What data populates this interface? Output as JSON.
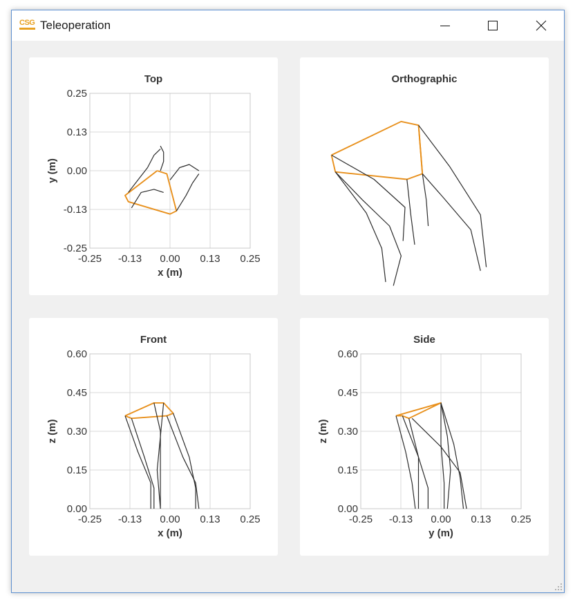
{
  "window": {
    "title": "Teleoperation",
    "logo_text": "CSG",
    "accent": "#e8a020"
  },
  "icons": {
    "minimize": "minimize-icon",
    "maximize": "maximize-icon",
    "close": "close-icon",
    "resize": "resize-grip-icon"
  },
  "colors": {
    "frame": "#e8901c",
    "legs": "#2b2b2b",
    "grid": "#d9d9d9",
    "axis": "#c8c8c8",
    "text": "#333333"
  },
  "chart_data": [
    {
      "type": "line",
      "title": "Top",
      "xlabel": "x (m)",
      "ylabel": "y (m)",
      "xlim": [
        -0.25,
        0.25
      ],
      "ylim": [
        -0.25,
        0.25
      ],
      "xticks": [
        "-0.25",
        "-0.13",
        "0.00",
        "0.13",
        "0.25"
      ],
      "yticks": [
        "-0.25",
        "-0.13",
        "0.00",
        "0.13",
        "0.25"
      ],
      "grid": true,
      "series": [
        {
          "role": "frame",
          "points": [
            [
              -0.04,
              0.0
            ],
            [
              -0.14,
              -0.08
            ],
            [
              -0.13,
              -0.1
            ],
            [
              0.0,
              -0.14
            ],
            [
              0.02,
              -0.13
            ],
            [
              -0.01,
              -0.01
            ],
            [
              -0.04,
              0.0
            ]
          ]
        },
        {
          "role": "leg",
          "points": [
            [
              -0.13,
              -0.07
            ],
            [
              -0.1,
              -0.03
            ],
            [
              -0.07,
              0.01
            ],
            [
              -0.05,
              0.05
            ],
            [
              -0.03,
              0.07
            ]
          ]
        },
        {
          "role": "leg",
          "points": [
            [
              -0.03,
              0.08
            ],
            [
              -0.02,
              0.06
            ],
            [
              -0.02,
              0.03
            ],
            [
              -0.03,
              0.0
            ]
          ]
        },
        {
          "role": "leg",
          "points": [
            [
              0.0,
              -0.03
            ],
            [
              0.03,
              0.01
            ],
            [
              0.06,
              0.02
            ],
            [
              0.09,
              0.0
            ]
          ]
        },
        {
          "role": "leg",
          "points": [
            [
              0.02,
              -0.13
            ],
            [
              0.05,
              -0.08
            ],
            [
              0.07,
              -0.04
            ],
            [
              0.09,
              -0.01
            ]
          ]
        },
        {
          "role": "leg",
          "points": [
            [
              -0.12,
              -0.12
            ],
            [
              -0.09,
              -0.07
            ],
            [
              -0.05,
              -0.06
            ],
            [
              -0.02,
              -0.07
            ]
          ]
        }
      ]
    },
    {
      "type": "line",
      "title": "Orthographic",
      "series": [
        {
          "role": "frame",
          "points": [
            [
              0.02,
              0.32
            ],
            [
              0.38,
              0.14
            ],
            [
              0.47,
              0.16
            ],
            [
              0.49,
              0.42
            ],
            [
              0.41,
              0.45
            ],
            [
              0.04,
              0.41
            ],
            [
              0.02,
              0.32
            ]
          ]
        },
        {
          "role": "frame",
          "points": [
            [
              0.47,
              0.16
            ],
            [
              0.49,
              0.42
            ]
          ]
        },
        {
          "role": "leg",
          "points": [
            [
              0.04,
              0.41
            ],
            [
              0.2,
              0.63
            ],
            [
              0.28,
              0.82
            ],
            [
              0.3,
              1.0
            ]
          ]
        },
        {
          "role": "leg",
          "points": [
            [
              0.04,
              0.41
            ],
            [
              0.18,
              0.56
            ],
            [
              0.32,
              0.7
            ],
            [
              0.38,
              0.86
            ],
            [
              0.34,
              1.02
            ]
          ]
        },
        {
          "role": "leg",
          "points": [
            [
              0.02,
              0.32
            ],
            [
              0.24,
              0.45
            ],
            [
              0.4,
              0.6
            ],
            [
              0.39,
              0.78
            ]
          ]
        },
        {
          "role": "leg",
          "points": [
            [
              0.41,
              0.45
            ],
            [
              0.43,
              0.64
            ],
            [
              0.45,
              0.8
            ]
          ]
        },
        {
          "role": "leg",
          "points": [
            [
              0.49,
              0.42
            ],
            [
              0.6,
              0.55
            ],
            [
              0.74,
              0.72
            ],
            [
              0.79,
              0.94
            ]
          ]
        },
        {
          "role": "leg",
          "points": [
            [
              0.47,
              0.16
            ],
            [
              0.63,
              0.38
            ],
            [
              0.79,
              0.64
            ],
            [
              0.82,
              0.92
            ]
          ]
        },
        {
          "role": "leg",
          "points": [
            [
              0.49,
              0.42
            ],
            [
              0.51,
              0.56
            ],
            [
              0.52,
              0.7
            ]
          ]
        }
      ]
    },
    {
      "type": "line",
      "title": "Front",
      "xlabel": "x (m)",
      "ylabel": "z (m)",
      "xlim": [
        -0.25,
        0.25
      ],
      "ylim": [
        0.0,
        0.6
      ],
      "xticks": [
        "-0.25",
        "-0.13",
        "0.00",
        "0.13",
        "0.25"
      ],
      "yticks": [
        "0.00",
        "0.15",
        "0.30",
        "0.45",
        "0.60"
      ],
      "grid": true,
      "series": [
        {
          "role": "frame",
          "points": [
            [
              -0.14,
              0.36
            ],
            [
              -0.05,
              0.41
            ],
            [
              -0.02,
              0.41
            ],
            [
              0.01,
              0.37
            ],
            [
              -0.01,
              0.36
            ],
            [
              -0.12,
              0.35
            ],
            [
              -0.14,
              0.36
            ]
          ]
        },
        {
          "role": "leg",
          "points": [
            [
              -0.14,
              0.36
            ],
            [
              -0.1,
              0.22
            ],
            [
              -0.06,
              0.1
            ],
            [
              -0.06,
              0.0
            ]
          ]
        },
        {
          "role": "leg",
          "points": [
            [
              -0.12,
              0.35
            ],
            [
              -0.08,
              0.2
            ],
            [
              -0.05,
              0.08
            ],
            [
              -0.05,
              0.0
            ]
          ]
        },
        {
          "role": "leg",
          "points": [
            [
              -0.05,
              0.41
            ],
            [
              -0.03,
              0.3
            ],
            [
              -0.03,
              0.15
            ],
            [
              -0.03,
              0.0
            ]
          ]
        },
        {
          "role": "leg",
          "points": [
            [
              -0.02,
              0.41
            ],
            [
              -0.03,
              0.28
            ],
            [
              -0.04,
              0.15
            ],
            [
              -0.03,
              0.0
            ]
          ]
        },
        {
          "role": "leg",
          "points": [
            [
              0.01,
              0.37
            ],
            [
              0.06,
              0.2
            ],
            [
              0.08,
              0.08
            ],
            [
              0.08,
              0.0
            ]
          ]
        },
        {
          "role": "leg",
          "points": [
            [
              -0.01,
              0.36
            ],
            [
              0.04,
              0.2
            ],
            [
              0.08,
              0.1
            ],
            [
              0.09,
              0.0
            ]
          ]
        }
      ]
    },
    {
      "type": "line",
      "title": "Side",
      "xlabel": "y (m)",
      "ylabel": "z (m)",
      "xlim": [
        -0.25,
        0.25
      ],
      "ylim": [
        0.0,
        0.6
      ],
      "xticks": [
        "-0.25",
        "-0.13",
        "0.00",
        "0.13",
        "0.25"
      ],
      "yticks": [
        "0.00",
        "0.15",
        "0.30",
        "0.45",
        "0.60"
      ],
      "grid": true,
      "series": [
        {
          "role": "frame",
          "points": [
            [
              -0.14,
              0.36
            ],
            [
              0.0,
              0.41
            ],
            [
              0.0,
              0.41
            ],
            [
              -0.1,
              0.35
            ],
            [
              -0.12,
              0.36
            ],
            [
              -0.14,
              0.36
            ]
          ]
        },
        {
          "role": "leg",
          "points": [
            [
              -0.14,
              0.36
            ],
            [
              -0.11,
              0.22
            ],
            [
              -0.09,
              0.1
            ],
            [
              -0.08,
              0.0
            ]
          ]
        },
        {
          "role": "leg",
          "points": [
            [
              -0.12,
              0.36
            ],
            [
              -0.07,
              0.2
            ],
            [
              -0.04,
              0.08
            ],
            [
              -0.04,
              0.0
            ]
          ]
        },
        {
          "role": "leg",
          "points": [
            [
              -0.1,
              0.35
            ],
            [
              -0.07,
              0.2
            ],
            [
              -0.07,
              0.0
            ]
          ]
        },
        {
          "role": "leg",
          "points": [
            [
              0.0,
              0.41
            ],
            [
              0.02,
              0.28
            ],
            [
              0.03,
              0.15
            ],
            [
              0.02,
              0.0
            ]
          ]
        },
        {
          "role": "leg",
          "points": [
            [
              0.0,
              0.41
            ],
            [
              0.04,
              0.25
            ],
            [
              0.06,
              0.12
            ],
            [
              0.07,
              0.0
            ]
          ]
        },
        {
          "role": "leg",
          "points": [
            [
              -0.09,
              0.35
            ],
            [
              0.0,
              0.24
            ],
            [
              0.06,
              0.14
            ],
            [
              0.08,
              0.0
            ]
          ]
        },
        {
          "role": "leg",
          "points": [
            [
              0.0,
              0.41
            ],
            [
              0.0,
              0.25
            ],
            [
              0.01,
              0.1
            ],
            [
              0.01,
              0.0
            ]
          ]
        }
      ]
    }
  ]
}
